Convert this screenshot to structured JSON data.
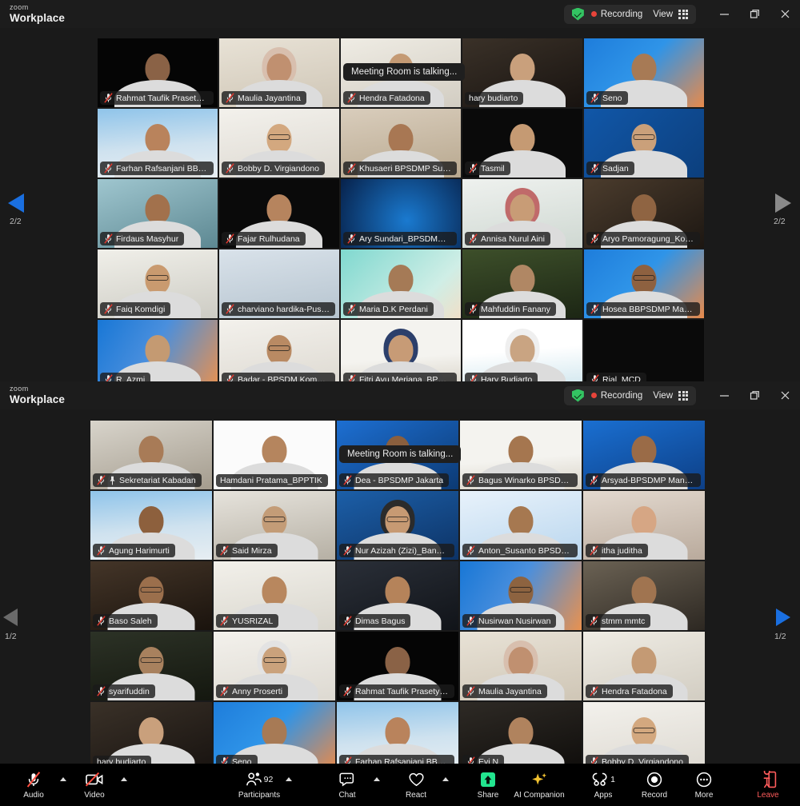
{
  "app": {
    "brand_small": "zoom",
    "brand_large": "Workplace"
  },
  "windows": [
    {
      "id": "window-top",
      "titlebar": {
        "encryption_icon": "shield-check-icon",
        "recording_label": "Recording",
        "view_label": "View",
        "view_icon": "grid-icon",
        "minimize_icon": "minimize-icon",
        "restore_icon": "restore-icon",
        "close_icon": "close-icon"
      },
      "toast": "Meeting Room is talking...",
      "page_indicator_left": "2/2",
      "page_indicator_right": "2/2",
      "prev_icon": "arrow-left-icon",
      "next_icon": "arrow-right-icon",
      "participants": [
        {
          "name": "Rahmat Taufik Prasetyo_Ko...",
          "muted": true,
          "pinned": false,
          "active": false,
          "bg": "logo-dark",
          "skin": "#8a6246"
        },
        {
          "name": "Maulia Jayantina",
          "muted": true,
          "pinned": false,
          "active": false,
          "bg": "room-cream",
          "skin": "#c09070",
          "hijab": "#d8bfae"
        },
        {
          "name": "Hendra Fatadona",
          "muted": true,
          "pinned": false,
          "active": false,
          "bg": "office-wall",
          "skin": "#c49a74"
        },
        {
          "name": "hary budiarto",
          "muted": false,
          "pinned": false,
          "active": false,
          "bg": "dark-room",
          "skin": "#c9a07c"
        },
        {
          "name": "Seno",
          "muted": true,
          "pinned": false,
          "active": false,
          "bg": "blue-vb",
          "skin": "#a77a55"
        },
        {
          "name": "Farhan Rafsanjani BBPSDMP",
          "muted": true,
          "pinned": false,
          "active": false,
          "bg": "building-sky",
          "skin": "#b9835c"
        },
        {
          "name": "Bobby D. Virgiandono",
          "muted": true,
          "pinned": false,
          "active": false,
          "bg": "white-room",
          "skin": "#d3a87f",
          "glasses": true
        },
        {
          "name": "Khusaeri BPSDMP Surabaya",
          "muted": true,
          "pinned": false,
          "active": false,
          "bg": "tan-room",
          "skin": "#a87753"
        },
        {
          "name": "Tasmil",
          "muted": true,
          "pinned": false,
          "active": false,
          "bg": "black",
          "skin": "#c59a73"
        },
        {
          "name": "Sadjan",
          "muted": true,
          "pinned": false,
          "active": false,
          "bg": "blue-chevron",
          "skin": "#caa07a",
          "glasses": true
        },
        {
          "name": "Firdaus Masyhur",
          "muted": true,
          "pinned": false,
          "active": false,
          "bg": "teal-office",
          "skin": "#a2714c"
        },
        {
          "name": "Fajar Rulhudana",
          "muted": true,
          "pinned": false,
          "active": false,
          "bg": "black-white",
          "skin": "#b6845e"
        },
        {
          "name": "Ary Sundari_BPSDMP Jakarta",
          "muted": true,
          "pinned": false,
          "active": true,
          "bg": "blue-tech",
          "skin": null
        },
        {
          "name": "Annisa Nurul Aini",
          "muted": true,
          "pinned": false,
          "active": false,
          "bg": "light-room",
          "skin": "#c89c76",
          "hijab": "#c06a6a"
        },
        {
          "name": "Aryo Pamoragung_Komdigi",
          "muted": true,
          "pinned": false,
          "active": false,
          "bg": "studio",
          "skin": "#8f6442"
        },
        {
          "name": "Faiq Komdigi",
          "muted": true,
          "pinned": false,
          "active": false,
          "bg": "bright-room",
          "skin": "#c99a6f",
          "glasses": true
        },
        {
          "name": "charviano hardika-Pusdiklat...",
          "muted": true,
          "pinned": false,
          "active": false,
          "bg": "logo-swirl",
          "skin": null
        },
        {
          "name": "Maria D.K Perdani",
          "muted": true,
          "pinned": false,
          "active": false,
          "bg": "mint-vb",
          "skin": "#a57a56"
        },
        {
          "name": "Mahfuddin Fanany",
          "muted": true,
          "pinned": false,
          "active": false,
          "bg": "forest-vb",
          "skin": "#b08764"
        },
        {
          "name": "Hosea BBPSDMP Makassar",
          "muted": true,
          "pinned": false,
          "active": false,
          "bg": "blue-vb",
          "skin": "#8e6140",
          "glasses": true
        },
        {
          "name": "R. Azmi",
          "muted": true,
          "pinned": false,
          "active": false,
          "bg": "blue-orange-vb",
          "skin": "#c49a72"
        },
        {
          "name": "Badar - BPSDM Komdigi",
          "muted": true,
          "pinned": false,
          "active": false,
          "bg": "white-room",
          "skin": "#b98a63",
          "glasses": true
        },
        {
          "name": "Fitri Ayu Meriana_BPSDMP ...",
          "muted": true,
          "pinned": false,
          "active": false,
          "bg": "surabaya-banner",
          "skin": "#c79b76",
          "hijab": "#2c3f6b"
        },
        {
          "name": "Hary Budiarto",
          "muted": true,
          "pinned": false,
          "active": false,
          "bg": "slide-rapat",
          "skin": "#c9a482",
          "hijab": "#efefef"
        },
        {
          "name": "Rial_MCD",
          "muted": true,
          "pinned": false,
          "active": false,
          "bg": "black",
          "skin": null
        }
      ]
    },
    {
      "id": "window-bottom",
      "titlebar": {
        "encryption_icon": "shield-check-icon",
        "recording_label": "Recording",
        "view_label": "View",
        "view_icon": "grid-icon",
        "minimize_icon": "minimize-icon",
        "restore_icon": "restore-icon",
        "close_icon": "close-icon"
      },
      "toast": "Meeting Room is talking...",
      "page_indicator_left": "1/2",
      "page_indicator_right": "1/2",
      "prev_icon": "arrow-left-icon",
      "next_icon": "arrow-right-icon",
      "participants": [
        {
          "name": "Sekretariat Kabadan",
          "muted": true,
          "pinned": true,
          "active": false,
          "bg": "conference-room",
          "skin": "#a87b57"
        },
        {
          "name": "Hamdani Pratama_BPPTIK",
          "muted": false,
          "pinned": false,
          "active": true,
          "bg": "poster-white",
          "skin": "#b5855e"
        },
        {
          "name": "Dea - BPSDMP Jakarta",
          "muted": true,
          "pinned": false,
          "active": false,
          "bg": "isometric-blue",
          "skin": "#8a5f3e"
        },
        {
          "name": "Bagus Winarko BPSDMP Sur...",
          "muted": true,
          "pinned": false,
          "active": false,
          "bg": "surabaya-banner",
          "skin": "#a5764f"
        },
        {
          "name": "Arsyad-BPSDMP Manado",
          "muted": true,
          "pinned": false,
          "active": false,
          "bg": "vsga-blue",
          "skin": "#9a6b47"
        },
        {
          "name": "Agung Harimurti",
          "muted": true,
          "pinned": false,
          "active": false,
          "bg": "building-sky",
          "skin": "#8d603d"
        },
        {
          "name": "Said Mirza",
          "muted": true,
          "pinned": false,
          "active": false,
          "bg": "office-blinds",
          "skin": "#c39c77",
          "glasses": true
        },
        {
          "name": "Nur Azizah (Zizi)_Bandung ",
          "muted": true,
          "pinned": false,
          "active": false,
          "bg": "bpsdmp-blue",
          "skin": "#c79a73",
          "hijab": "#2b2b2b",
          "glasses": true
        },
        {
          "name": "Anton_Susanto BPSDMP Yo...",
          "muted": true,
          "pinned": false,
          "active": false,
          "bg": "indonesia-vb",
          "skin": "#a67850"
        },
        {
          "name": "itha juditha",
          "muted": true,
          "pinned": false,
          "active": false,
          "bg": "blur-room",
          "skin": "#d6a684"
        },
        {
          "name": "Baso Saleh",
          "muted": true,
          "pinned": false,
          "active": false,
          "bg": "dark-brown",
          "skin": "#9b6f4c",
          "glasses": true
        },
        {
          "name": "YUSRIZAL",
          "muted": true,
          "pinned": false,
          "active": false,
          "bg": "white-wall",
          "skin": "#b8875e"
        },
        {
          "name": "Dimas Bagus",
          "muted": true,
          "pinned": false,
          "active": false,
          "bg": "control-room",
          "skin": "#b5835a"
        },
        {
          "name": "Nusirwan Nusirwan",
          "muted": true,
          "pinned": false,
          "active": false,
          "bg": "blue-orange-vb",
          "skin": "#8d6340",
          "glasses": true
        },
        {
          "name": "stmm mmtc",
          "muted": true,
          "pinned": false,
          "active": false,
          "bg": "meeting-hall",
          "skin": "#a07450"
        },
        {
          "name": "syarifuddin",
          "muted": true,
          "pinned": false,
          "active": false,
          "bg": "dark-green",
          "skin": "#a8815e",
          "glasses": true
        },
        {
          "name": "Anny Proserti",
          "muted": true,
          "pinned": false,
          "active": false,
          "bg": "white-room",
          "skin": "#caa27c",
          "hijab": "#e3e3e3",
          "glasses": true
        },
        {
          "name": "Rahmat Taufik Prasetyo_Ko...",
          "muted": true,
          "pinned": false,
          "active": false,
          "bg": "logo-dark",
          "skin": "#8a6246"
        },
        {
          "name": "Maulia Jayantina",
          "muted": true,
          "pinned": false,
          "active": false,
          "bg": "room-cream",
          "skin": "#c09070",
          "hijab": "#d8bfae"
        },
        {
          "name": "Hendra Fatadona",
          "muted": true,
          "pinned": false,
          "active": false,
          "bg": "office-wall",
          "skin": "#c49a74"
        },
        {
          "name": "hary budiarto",
          "muted": false,
          "pinned": false,
          "active": false,
          "bg": "dark-room",
          "skin": "#c9a07c"
        },
        {
          "name": "Seno",
          "muted": true,
          "pinned": false,
          "active": false,
          "bg": "blue-vb",
          "skin": "#a77a55"
        },
        {
          "name": "Farhan Rafsanjani BBPSDMP...",
          "muted": true,
          "pinned": false,
          "active": false,
          "bg": "building-sky",
          "skin": "#b9835c"
        },
        {
          "name": "Evi N",
          "muted": true,
          "pinned": false,
          "active": false,
          "bg": "dim-room",
          "skin": "#b0835e"
        },
        {
          "name": "Bobby D. Virgiandono",
          "muted": true,
          "pinned": false,
          "active": false,
          "bg": "white-room",
          "skin": "#d3a87f",
          "glasses": true
        }
      ]
    }
  ],
  "toolbar": {
    "items": [
      {
        "label": "Audio",
        "icon": "microphone-muted-icon",
        "caret": true,
        "badge": null
      },
      {
        "label": "Video",
        "icon": "camera-muted-icon",
        "caret": true,
        "badge": null
      },
      {
        "label": "Participants",
        "icon": "participants-icon",
        "caret": true,
        "badge": "92"
      },
      {
        "label": "Chat",
        "icon": "chat-icon",
        "caret": true,
        "badge": null
      },
      {
        "label": "React",
        "icon": "heart-icon",
        "caret": true,
        "badge": null
      },
      {
        "label": "Share",
        "icon": "share-screen-icon",
        "caret": false,
        "badge": null
      },
      {
        "label": "AI Companion",
        "icon": "ai-sparkle-icon",
        "caret": false,
        "badge": null
      },
      {
        "label": "Apps",
        "icon": "apps-icon",
        "caret": false,
        "badge": "1"
      },
      {
        "label": "Record",
        "icon": "record-icon",
        "caret": false,
        "badge": null
      },
      {
        "label": "More",
        "icon": "more-ellipsis-icon",
        "caret": false,
        "badge": null
      }
    ],
    "leave": {
      "label": "Leave",
      "icon": "leave-door-icon"
    }
  },
  "colors": {
    "accent_green": "#33c462",
    "recording_red": "#e8443a",
    "active_speaker": "#f0a500",
    "share_green": "#22e58f",
    "ai_yellow": "#f2c230",
    "leave_red": "#ff5c5c",
    "window_bg": "#1a1a1a",
    "titlebar_bg": "#1c1c1c"
  }
}
